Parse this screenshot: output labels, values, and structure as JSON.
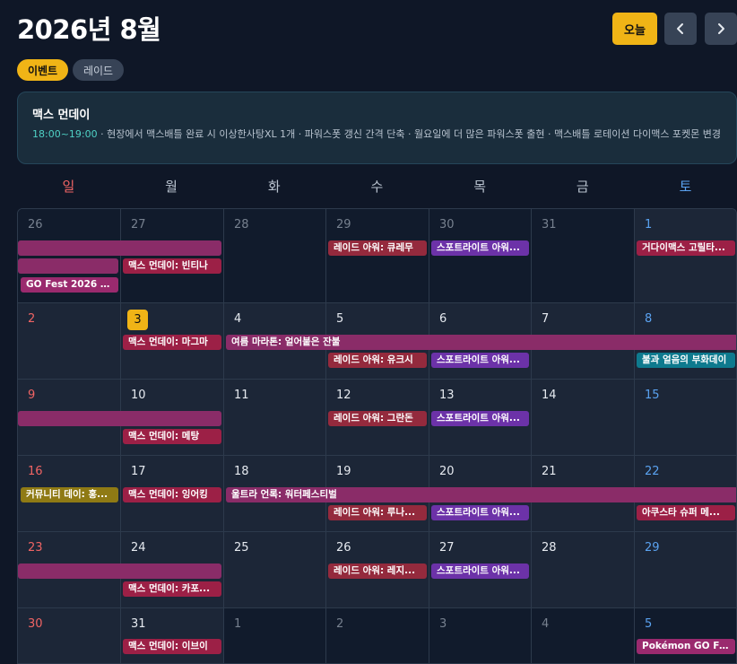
{
  "header": {
    "title": "2026년 8월",
    "today_label": "오늘"
  },
  "filters": [
    {
      "label": "이벤트",
      "active": true
    },
    {
      "label": "레이드",
      "active": false
    }
  ],
  "info": {
    "title": "맥스 먼데이",
    "time": "18:00~19:00",
    "desc": " · 현장에서 맥스배틀 완료 시 이상한사탕XL 1개 · 파워스폿 갱신 간격 단축 · 월요일에 더 많은 파워스폿 출현 · 맥스배틀 로테이션 다이맥스 포켓몬 변경"
  },
  "weekdays": [
    "일",
    "월",
    "화",
    "수",
    "목",
    "금",
    "토"
  ],
  "weeks": [
    [
      "26",
      "27",
      "28",
      "29",
      "30",
      "31",
      "1"
    ],
    [
      "2",
      "3",
      "4",
      "5",
      "6",
      "7",
      "8"
    ],
    [
      "9",
      "10",
      "11",
      "12",
      "13",
      "14",
      "15"
    ],
    [
      "16",
      "17",
      "18",
      "19",
      "20",
      "21",
      "22"
    ],
    [
      "23",
      "24",
      "25",
      "26",
      "27",
      "28",
      "29"
    ],
    [
      "30",
      "31",
      "1",
      "2",
      "3",
      "4",
      "5"
    ]
  ],
  "events": {
    "w0_gofest": "GO Fest 2026 글...",
    "w0_max": "맥스 먼데이: 빈티나",
    "w0_raid": "레이드 아워: 큐레무",
    "w0_spot": "스포트라이트 아워...",
    "w0_sat": "거다이맥스 고릴타...",
    "w1_max": "맥스 먼데이: 마그마",
    "w1_long": "여름 마라톤: 얼어붙은 잔불",
    "w1_raid": "레이드 아워: 유크시",
    "w1_spot": "스포트라이트 아워...",
    "w1_sat": "불과 얼음의 부화데이",
    "w2_max": "맥스 먼데이: 메탕",
    "w2_raid": "레이드 아워: 그란돈",
    "w2_spot": "스포트라이트 아워...",
    "w3_sun": "커뮤니티 데이: 홍...",
    "w3_max": "맥스 먼데이: 잉어킹",
    "w3_long": "울트라 언록: 워터페스티벌",
    "w3_raid": "레이드 아워: 루나...",
    "w3_spot": "스포트라이트 아워...",
    "w3_sat": "아쿠스타 슈퍼 메...",
    "w4_max": "맥스 먼데이: 카포...",
    "w4_raid": "레이드 아워: 레지...",
    "w4_spot": "스포트라이트 아워...",
    "w5_max": "맥스 먼데이: 이브이",
    "w5_sat": "Pokémon GO Fes..."
  },
  "colors": {
    "accent": "#f0b416",
    "background": "#0f1727",
    "sunday": "#f06464",
    "saturday": "#5aa2f0"
  }
}
